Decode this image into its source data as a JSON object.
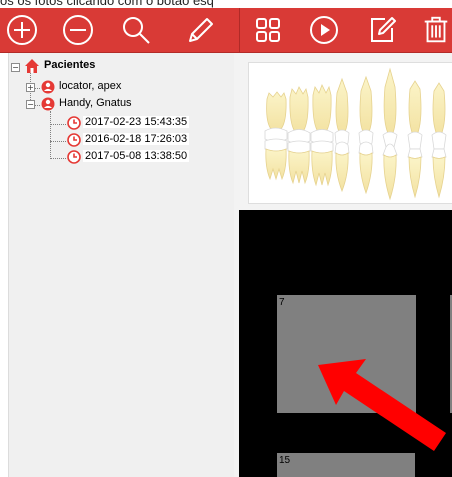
{
  "top_text": "os os fotos clicando com o botão esq",
  "toolbar": {
    "buttons": [
      {
        "name": "add",
        "icon": "plus-circle-icon"
      },
      {
        "name": "remove",
        "icon": "minus-circle-icon"
      },
      {
        "name": "search",
        "icon": "search-icon"
      },
      {
        "name": "edit",
        "icon": "pencil-icon"
      },
      {
        "name": "grid",
        "icon": "grid-icon"
      },
      {
        "name": "play",
        "icon": "play-icon"
      },
      {
        "name": "edit-doc",
        "icon": "edit-doc-icon"
      },
      {
        "name": "delete",
        "icon": "trash-icon"
      }
    ],
    "color": "#d93a36"
  },
  "tree": {
    "root_label": "Pacientes",
    "patients": [
      {
        "label": "locator, apex",
        "expanded": false
      },
      {
        "label": "Handy, Gnatus",
        "expanded": true
      }
    ],
    "sessions": [
      "2017-02-23 15:43:35",
      "2016-02-18 17:26:03",
      "2017-05-08 13:38:50"
    ]
  },
  "viewer": {
    "thumbnails": [
      {
        "label": "7"
      },
      {
        "label": "15"
      }
    ]
  },
  "annotation": {
    "arrow_color": "#ff0000"
  }
}
